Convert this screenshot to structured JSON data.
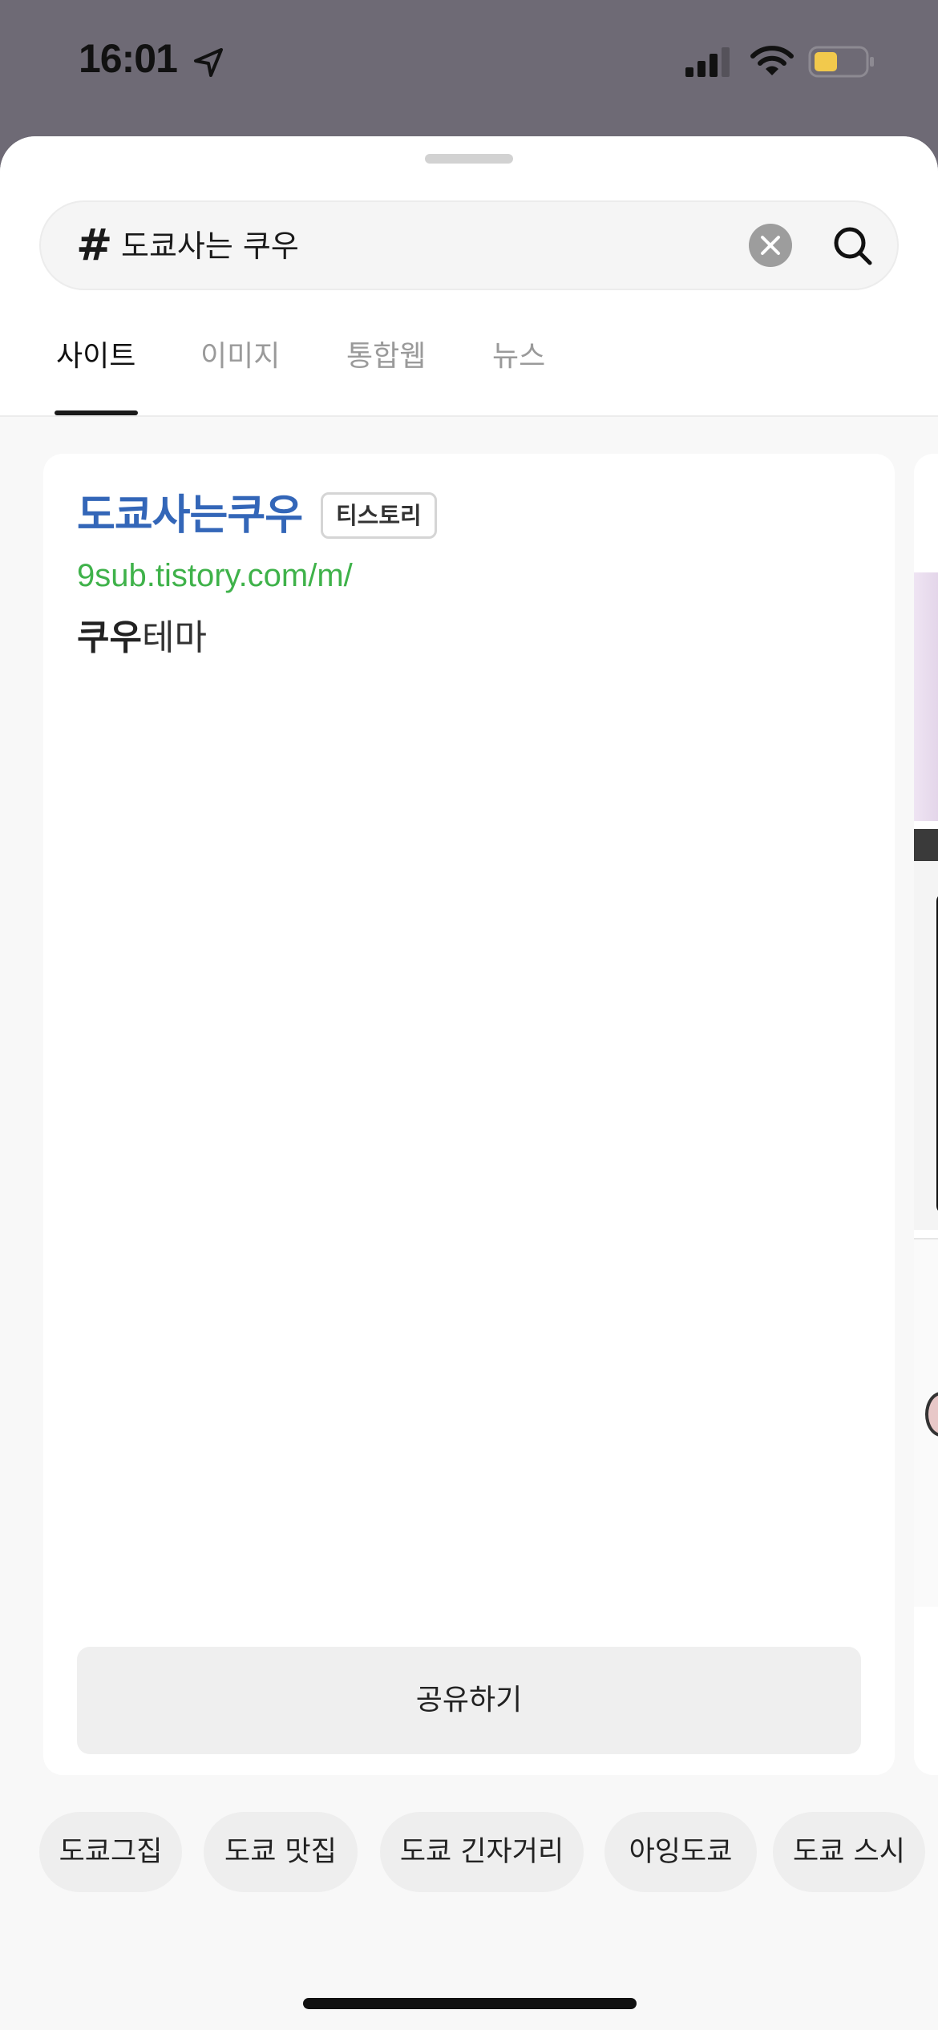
{
  "status_bar": {
    "time": "16:01"
  },
  "search": {
    "prefix": "#",
    "query": "도쿄사는 쿠우"
  },
  "tabs": [
    {
      "label": "사이트",
      "active": true
    },
    {
      "label": "이미지",
      "active": false
    },
    {
      "label": "통합웹",
      "active": false
    },
    {
      "label": "뉴스",
      "active": false
    }
  ],
  "result": {
    "title": "도쿄사는쿠우",
    "badge": "티스토리",
    "url": "9sub.tistory.com/m/",
    "desc_bold": "쿠우",
    "desc_rest": "테마",
    "share_label": "공유하기"
  },
  "related_keywords": [
    "도쿄그집",
    "도쿄 맛집",
    "도쿄 긴자거리",
    "아잉도쿄",
    "도쿄 스시"
  ],
  "colors": {
    "title": "#3366b8",
    "url": "#3fb24a",
    "battery": "#f2c94c",
    "backdrop": "#6e6a75"
  }
}
